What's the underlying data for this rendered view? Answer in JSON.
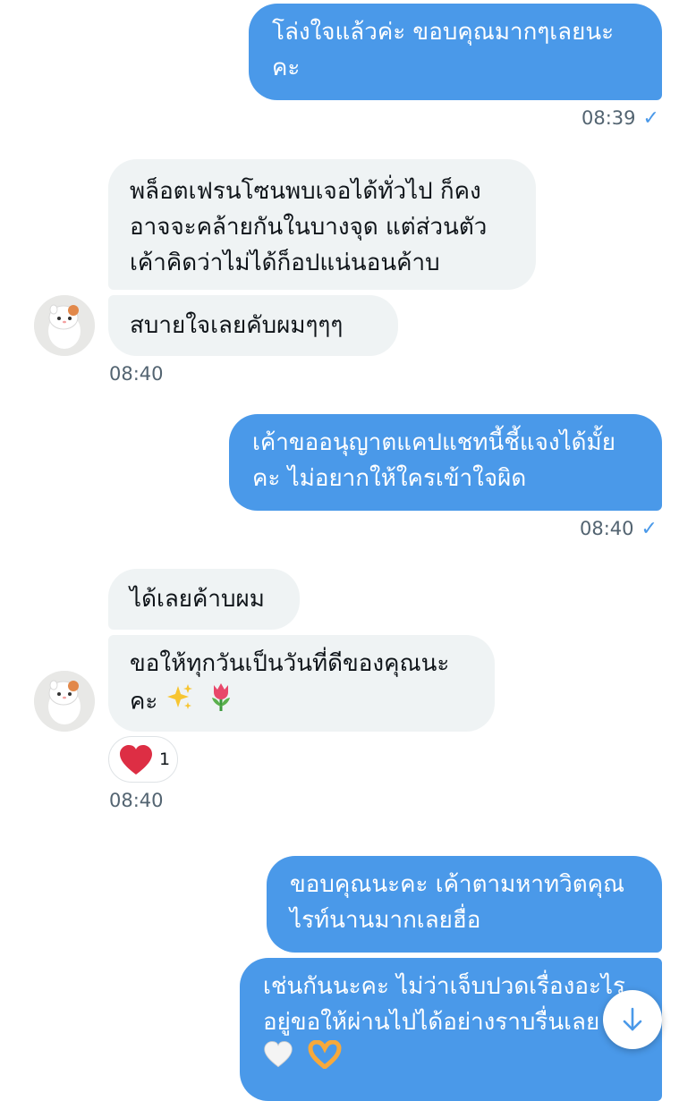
{
  "messages": {
    "m1": {
      "line1": "โล่งใจแล้วค่ะ ขอบคุณมากๆเลยนะ",
      "line2": "คะ",
      "time": "08:39"
    },
    "m2": {
      "line1": "พล็อตเฟรนโซนพบเจอได้ทั่วไป ก็คง",
      "line2": "อาจจะคล้ายกันในบางจุด แต่ส่วนตัว",
      "line3": "เค้าคิดว่าไม่ได้ก็อปแน่นอนค้าบ"
    },
    "m3": {
      "line1": "สบายใจเลยคับผมๆๆๆ",
      "time": "08:40"
    },
    "m4": {
      "line1": "เค้าขออนุญาตแคปแชทนี้ชี้แจงได้มั้ย",
      "line2": "คะ ไม่อยากให้ใครเข้าใจผิด",
      "time": "08:40"
    },
    "m5": {
      "line1": "ได้เลยค้าบผม"
    },
    "m6": {
      "line1": "ขอให้ทุกวันเป็นวันที่ดีของคุณนะ",
      "line2": "คะ",
      "time": "08:40"
    },
    "reaction": {
      "count": "1",
      "icon": "heart-icon",
      "color": "#e0245e"
    },
    "m7": {
      "line1": "ขอบคุณนะคะ เค้าตามหาทวิตคุณ",
      "line2": "ไรท์นานมากเลยฮื่อ"
    },
    "m8": {
      "line1": "เช่นกันนะคะ ไม่ว่าเจ็บปวดเรื่องอะไร",
      "line2": "อยู่ขอให้ผ่านไปได้อย่างราบรื่นเลย"
    }
  },
  "colors": {
    "outgoing": "#4a99e9",
    "incoming": "#eff3f4",
    "accent": "#4a99e9"
  },
  "icons": [
    "check-icon",
    "avatar",
    "heart-icon",
    "sparkles-icon",
    "tulip-icon",
    "white-heart-icon",
    "heart-hands-icon",
    "arrow-down-icon"
  ]
}
